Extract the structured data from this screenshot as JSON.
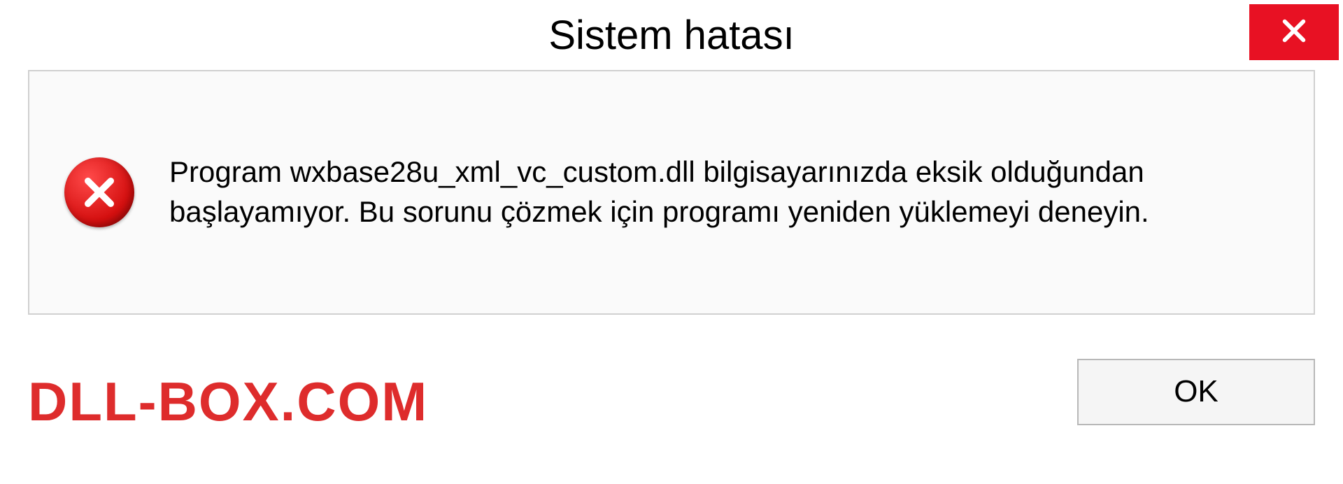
{
  "titlebar": {
    "title": "Sistem hatası"
  },
  "message": {
    "text": "Program wxbase28u_xml_vc_custom.dll bilgisayarınızda eksik olduğundan başlayamıyor. Bu sorunu çözmek için programı yeniden yüklemeyi deneyin."
  },
  "footer": {
    "watermark": "DLL-BOX.COM",
    "ok_label": "OK"
  },
  "colors": {
    "close_bg": "#e81123",
    "error_red": "#d40f0f",
    "watermark_red": "#de2c2c",
    "border_gray": "#d0d0d0"
  }
}
